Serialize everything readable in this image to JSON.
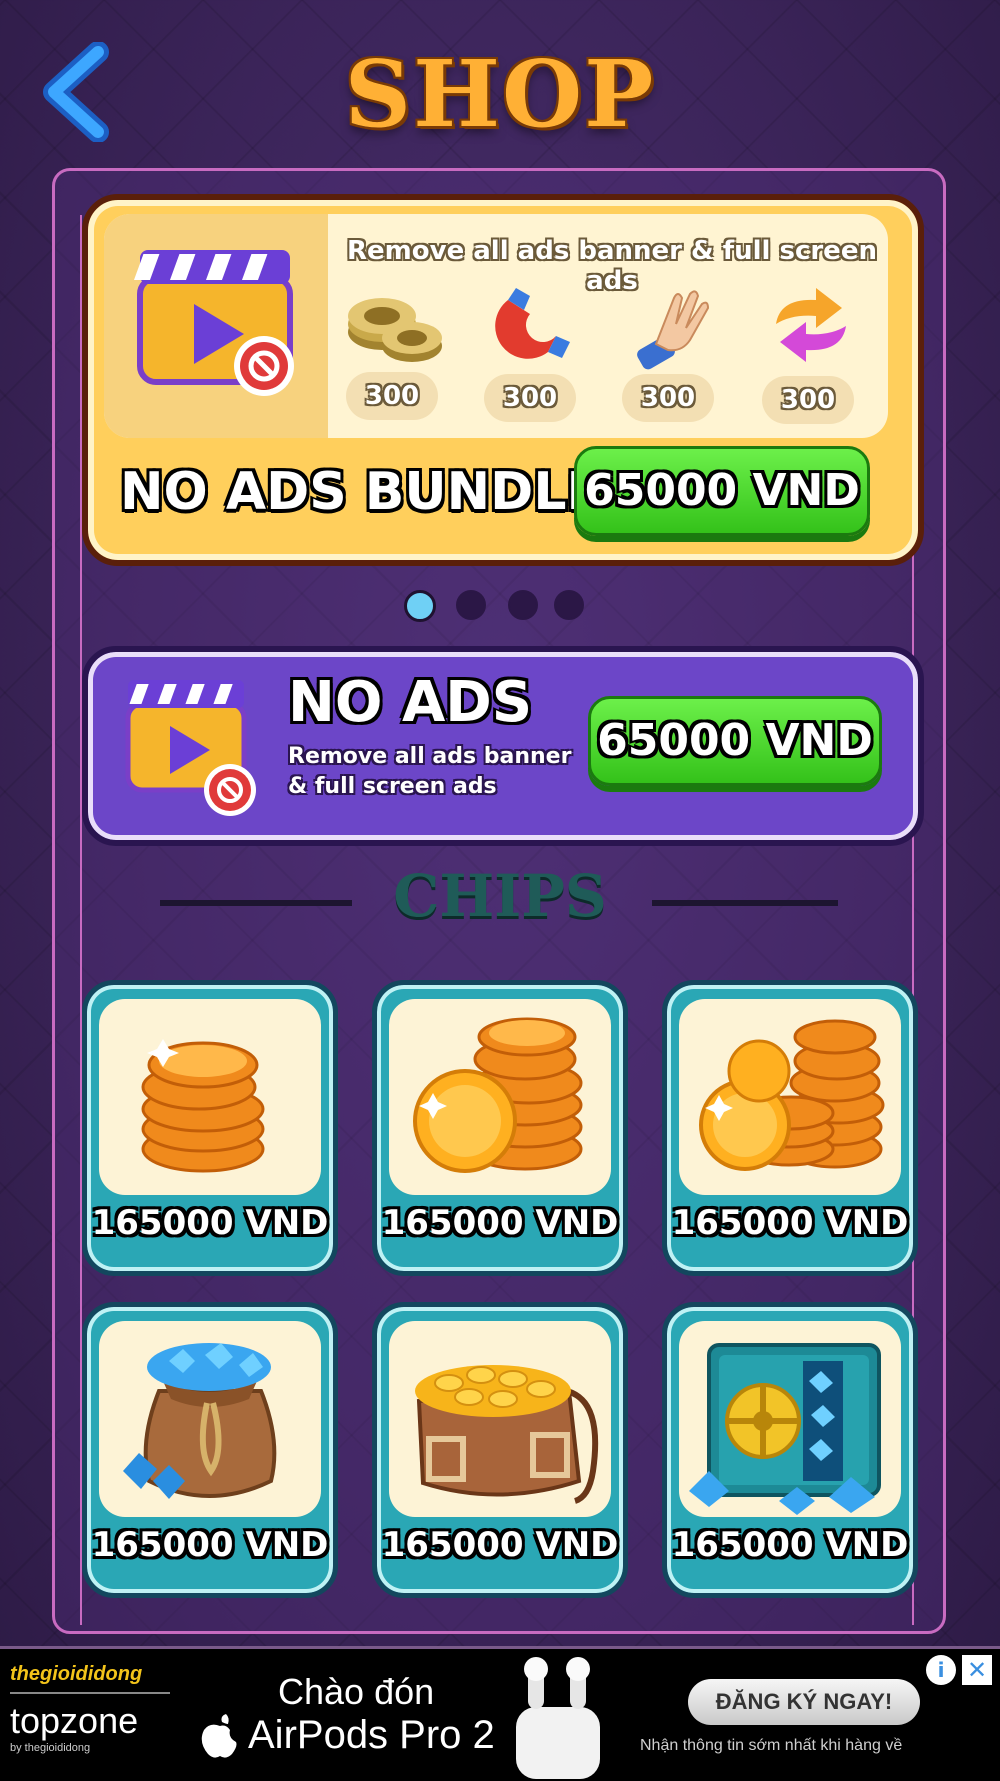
{
  "header": {
    "title": "SHOP"
  },
  "bundle": {
    "description": "Remove all ads banner & full screen ads",
    "items": [
      {
        "icon": "chips-stack-icon",
        "count": "300"
      },
      {
        "icon": "magnet-icon",
        "count": "300"
      },
      {
        "icon": "hand-icon",
        "count": "300"
      },
      {
        "icon": "shuffle-arrows-icon",
        "count": "300"
      }
    ],
    "title": "NO ADS BUNDLE",
    "price": "65000 VND"
  },
  "carousel": {
    "pages": 4,
    "active": 1
  },
  "noads": {
    "title": "NO ADS",
    "description": "Remove all ads banner & full screen ads",
    "price": "65000 VND"
  },
  "chips": {
    "title": "CHIPS",
    "items": [
      {
        "icon": "small-coin-stack-icon",
        "price": "165000 VND"
      },
      {
        "icon": "medium-coin-stack-icon",
        "price": "165000 VND"
      },
      {
        "icon": "large-coin-stack-icon",
        "price": "165000 VND"
      },
      {
        "icon": "gem-sack-icon",
        "price": "165000 VND"
      },
      {
        "icon": "coin-satchel-icon",
        "price": "165000 VND"
      },
      {
        "icon": "gem-safe-icon",
        "price": "165000 VND"
      }
    ]
  },
  "ad": {
    "brand_top": "thegioididong",
    "brand_main": "topzone",
    "brand_sub": "by thegioididong",
    "headline": "Chào đón",
    "product": "AirPods Pro 2",
    "cta": "ĐĂNG KÝ NGAY!",
    "subtext": "Nhận thông tin sớm nhất khi hàng về",
    "info_icon": "i",
    "close_icon": "✕"
  },
  "colors": {
    "accent_green": "#34c21a",
    "bundle_yellow": "#ffcf5c",
    "noads_purple": "#6c46c8",
    "chip_teal": "#2aa7b5",
    "title_orange": "#ffb035"
  }
}
